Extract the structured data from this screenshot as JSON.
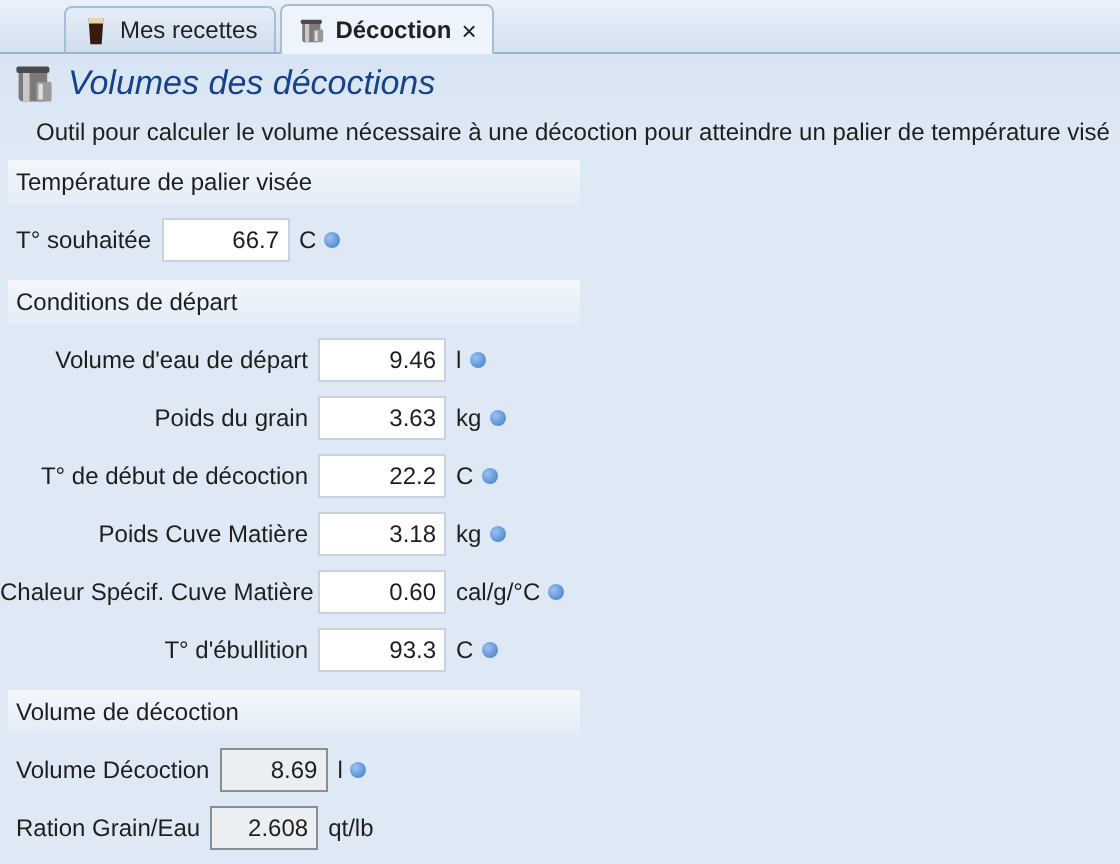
{
  "tabs": [
    {
      "label": "Mes recettes",
      "selected": false,
      "closable": false
    },
    {
      "label": "Décoction",
      "selected": true,
      "closable": true,
      "close": "×"
    }
  ],
  "header": {
    "title": "Volumes des décoctions",
    "description": "Outil pour calculer le volume nécessaire à une décoction pour atteindre un palier de température visé"
  },
  "sections": [
    {
      "title": "Température de palier visée",
      "kind": "stacked",
      "fields": [
        {
          "label": "T° souhaitée",
          "value": "66.7",
          "unit": "C",
          "readonly": false,
          "info": true
        }
      ]
    },
    {
      "title": "Conditions de départ",
      "kind": "aligned",
      "fields": [
        {
          "label": "Volume d'eau de départ",
          "value": "9.46",
          "unit": "l",
          "readonly": false,
          "info": true
        },
        {
          "label": "Poids du grain",
          "value": "3.63",
          "unit": "kg",
          "readonly": false,
          "info": true
        },
        {
          "label": "T° de début de décoction",
          "value": "22.2",
          "unit": "C",
          "readonly": false,
          "info": true
        },
        {
          "label": "Poids Cuve Matière",
          "value": "3.18",
          "unit": "kg",
          "readonly": false,
          "info": true
        },
        {
          "label": "Chaleur Spécif. Cuve Matière",
          "value": "0.60",
          "unit": "cal/g/°C",
          "readonly": false,
          "info": true
        },
        {
          "label": "T° d'ébullition",
          "value": "93.3",
          "unit": "C",
          "readonly": false,
          "info": true
        }
      ]
    },
    {
      "title": "Volume de décoction",
      "kind": "stacked",
      "fields": [
        {
          "label": "Volume Décoction",
          "value": "8.69",
          "unit": "l",
          "readonly": true,
          "info": true
        },
        {
          "label": "Ration Grain/Eau",
          "value": "2.608",
          "unit": "qt/lb",
          "readonly": true,
          "info": false
        }
      ]
    }
  ]
}
